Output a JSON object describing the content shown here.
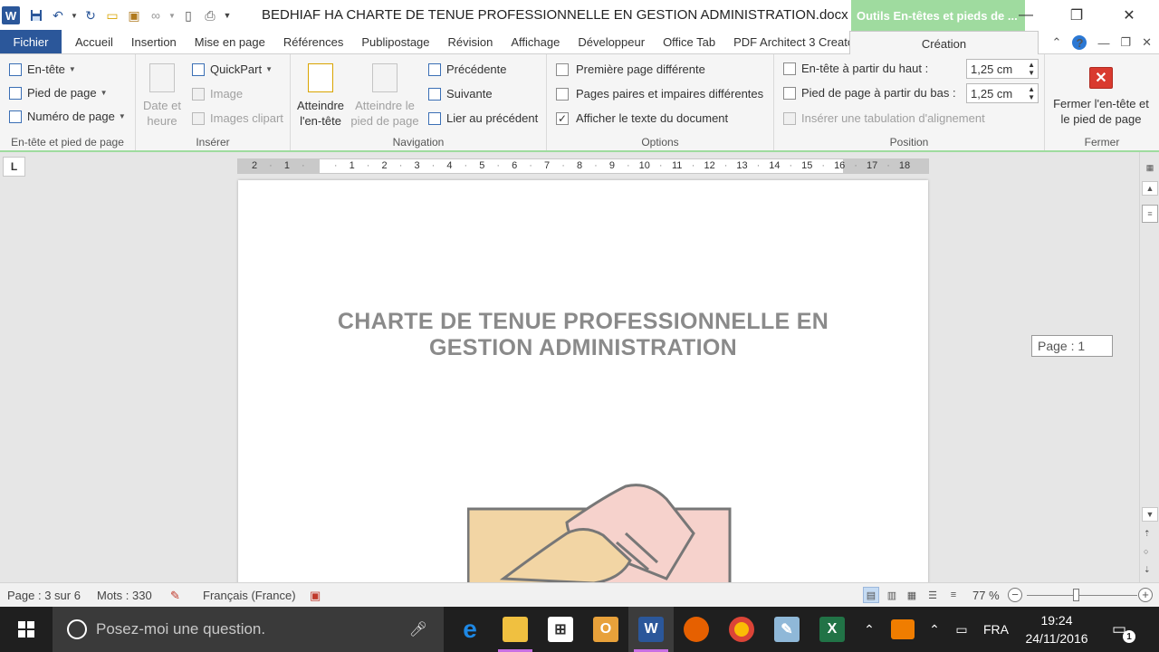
{
  "window": {
    "title": "BEDHIAF HA CHARTE DE TENUE PROFESSIONNELLE EN GESTION ADMINISTRATION.docx - M...",
    "context_tab_label": "Outils En-têtes et pieds de ...",
    "app_icon_letter": "W"
  },
  "tabs": {
    "file": "Fichier",
    "items": [
      "Accueil",
      "Insertion",
      "Mise en page",
      "Références",
      "Publipostage",
      "Révision",
      "Affichage",
      "Développeur",
      "Office Tab",
      "PDF Architect 3 Creator"
    ],
    "active": "Création"
  },
  "ribbon": {
    "header_footer": {
      "label": "En-tête et pied de page",
      "header": "En-tête",
      "footer": "Pied de page",
      "page_number": "Numéro de page"
    },
    "insert": {
      "label": "Insérer",
      "date_time_line1": "Date et",
      "date_time_line2": "heure",
      "quickpart": "QuickPart",
      "image": "Image",
      "clipart": "Images clipart"
    },
    "navigation": {
      "label": "Navigation",
      "goto_header_line1": "Atteindre",
      "goto_header_line2": "l'en-tête",
      "goto_footer_line1": "Atteindre le",
      "goto_footer_line2": "pied de page",
      "previous": "Précédente",
      "next": "Suivante",
      "link_previous": "Lier au précédent"
    },
    "options": {
      "label": "Options",
      "first_page": "Première page différente",
      "first_page_checked": false,
      "odd_even": "Pages paires et impaires différentes",
      "odd_even_checked": false,
      "show_doc_text": "Afficher le texte du document",
      "show_doc_text_checked": true
    },
    "position": {
      "label": "Position",
      "header_from_top": "En-tête à partir du haut :",
      "header_value": "1,25 cm",
      "footer_from_bottom": "Pied de page à partir du bas :",
      "footer_value": "1,25 cm",
      "insert_tab": "Insérer une tabulation d'alignement"
    },
    "close": {
      "label": "Fermer",
      "button_line1": "Fermer l'en-tête et",
      "button_line2": "le pied de page"
    }
  },
  "ruler": {
    "tab_selector": "L",
    "numbers": [
      "2",
      "1",
      "",
      "1",
      "2",
      "3",
      "4",
      "5",
      "6",
      "7",
      "8",
      "9",
      "10",
      "11",
      "12",
      "13",
      "14",
      "15",
      "16",
      "17",
      "18"
    ]
  },
  "document": {
    "title_line1": "CHARTE DE TENUE PROFESSIONNELLE EN",
    "title_line2": "GESTION ADMINISTRATION",
    "page_tooltip": "Page : 1"
  },
  "statusbar": {
    "page": "Page : 3 sur 6",
    "words": "Mots : 330",
    "language": "Français (France)",
    "zoom": "77 %",
    "zoom_level": 0.45
  },
  "taskbar": {
    "search_placeholder": "Posez-moi une question.",
    "language": "FRA",
    "time": "19:24",
    "date": "24/11/2016",
    "notification_count": "1"
  },
  "colors": {
    "word_blue": "#2b579a",
    "context_green": "#9fdb9f",
    "close_red": "#d93a2f",
    "title_grey": "#8a8a8a",
    "taskbar_bg": "#1f1f1f"
  }
}
